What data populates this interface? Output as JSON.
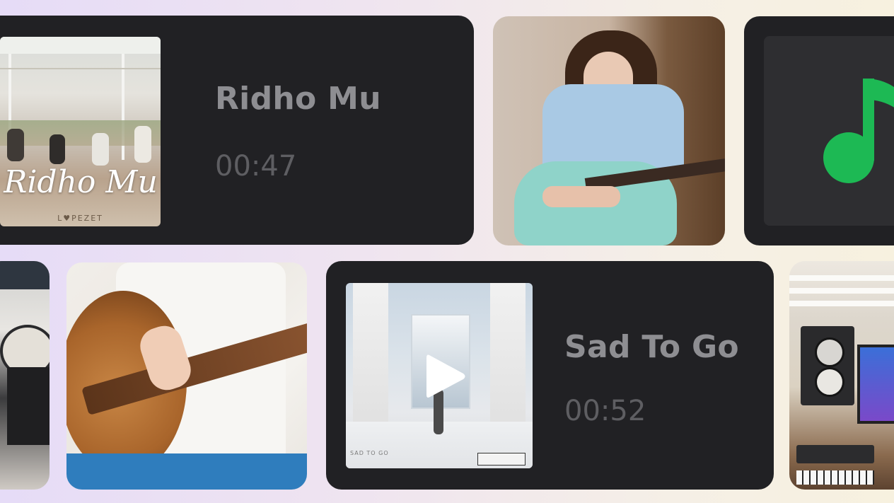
{
  "tracks": [
    {
      "title": "Ridho Mu",
      "duration": "00:47",
      "cover_text": "Ridho Mu",
      "cover_brand": "L♥PEZET"
    },
    {
      "title": "Sad To Go",
      "duration": "00:52",
      "cover_text": "SAD TO GO"
    }
  ],
  "music_icon_color": "#1db954",
  "card_color": "#212124",
  "icons": {
    "play": "play-icon",
    "music_note": "music-note-icon"
  }
}
